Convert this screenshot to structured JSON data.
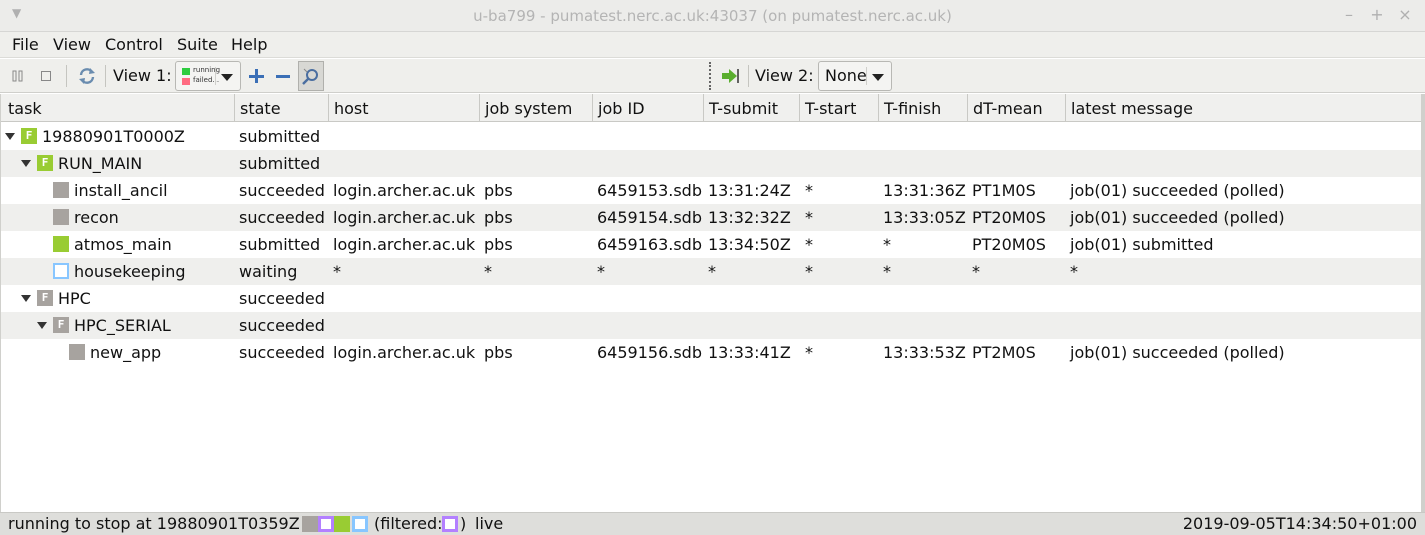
{
  "window": {
    "title": "u-ba799 - pumatest.nerc.ac.uk:43037 (on pumatest.nerc.ac.uk)"
  },
  "menu": [
    "File",
    "View",
    "Control",
    "Suite",
    "Help"
  ],
  "toolbar": {
    "view1_label": "View 1:",
    "view1_legend": [
      "running",
      "failed..."
    ],
    "view2_label": "View 2:",
    "view2_value": "None"
  },
  "columns": [
    "task",
    "state",
    "host",
    "job system",
    "job ID",
    "T-submit",
    "T-start",
    "T-finish",
    "dT-mean",
    "latest message"
  ],
  "colors": {
    "submitted": "#99cc33",
    "succeeded": "#a7a39f",
    "waiting": "#88c6ff",
    "held": "#b380ff",
    "running_legend": "#2ecc40",
    "failed_legend": "#ff6b81"
  },
  "rows": [
    {
      "level": 0,
      "type": "family",
      "expanded": true,
      "state_icon": "submitted",
      "task": "19880901T0000Z",
      "state": "submitted",
      "host": "",
      "job_system": "",
      "job_id": "",
      "t_submit": "",
      "t_start": "",
      "t_finish": "",
      "dt_mean": "",
      "message": ""
    },
    {
      "level": 1,
      "type": "family",
      "expanded": true,
      "state_icon": "submitted",
      "task": "RUN_MAIN",
      "state": "submitted",
      "host": "",
      "job_system": "",
      "job_id": "",
      "t_submit": "",
      "t_start": "",
      "t_finish": "",
      "dt_mean": "",
      "message": ""
    },
    {
      "level": 2,
      "type": "task",
      "state_icon": "succeeded",
      "task": "install_ancil",
      "state": "succeeded",
      "host": "login.archer.ac.uk",
      "job_system": "pbs",
      "job_id": "6459153.sdb",
      "t_submit": "13:31:24Z",
      "t_start": "*",
      "t_finish": "13:31:36Z",
      "dt_mean": "PT1M0S",
      "message": "job(01) succeeded (polled)"
    },
    {
      "level": 2,
      "type": "task",
      "state_icon": "succeeded",
      "task": "recon",
      "state": "succeeded",
      "host": "login.archer.ac.uk",
      "job_system": "pbs",
      "job_id": "6459154.sdb",
      "t_submit": "13:32:32Z",
      "t_start": "*",
      "t_finish": "13:33:05Z",
      "dt_mean": "PT20M0S",
      "message": "job(01) succeeded (polled)"
    },
    {
      "level": 2,
      "type": "task",
      "state_icon": "submitted",
      "task": "atmos_main",
      "state": "submitted",
      "host": "login.archer.ac.uk",
      "job_system": "pbs",
      "job_id": "6459163.sdb",
      "t_submit": "13:34:50Z",
      "t_start": "*",
      "t_finish": "*",
      "dt_mean": "PT20M0S",
      "message": "job(01) submitted"
    },
    {
      "level": 2,
      "type": "task",
      "state_icon": "waiting",
      "task": "housekeeping",
      "state": "waiting",
      "host": "*",
      "job_system": "*",
      "job_id": "*",
      "t_submit": "*",
      "t_start": "*",
      "t_finish": "*",
      "dt_mean": "*",
      "message": "*"
    },
    {
      "level": 1,
      "type": "family",
      "expanded": true,
      "state_icon": "succeeded",
      "task": "HPC",
      "state": "succeeded",
      "host": "",
      "job_system": "",
      "job_id": "",
      "t_submit": "",
      "t_start": "",
      "t_finish": "",
      "dt_mean": "",
      "message": ""
    },
    {
      "level": 2,
      "type": "family",
      "expanded": true,
      "state_icon": "succeeded",
      "task": "HPC_SERIAL",
      "state": "succeeded",
      "host": "",
      "job_system": "",
      "job_id": "",
      "t_submit": "",
      "t_start": "",
      "t_finish": "",
      "dt_mean": "",
      "message": ""
    },
    {
      "level": 3,
      "type": "task",
      "state_icon": "succeeded",
      "task": "new_app",
      "state": "succeeded",
      "host": "login.archer.ac.uk",
      "job_system": "pbs",
      "job_id": "6459156.sdb",
      "t_submit": "13:33:41Z",
      "t_start": "*",
      "t_finish": "13:33:53Z",
      "dt_mean": "PT2M0S",
      "message": "job(01) succeeded (polled)"
    }
  ],
  "family_letter": "F",
  "status": {
    "stop_text": "running to stop at 19880901T0359Z",
    "filtered_open": "(filtered:",
    "filtered_close": ")",
    "mode": "live",
    "timestamp": "2019-09-05T14:34:50+01:00"
  }
}
